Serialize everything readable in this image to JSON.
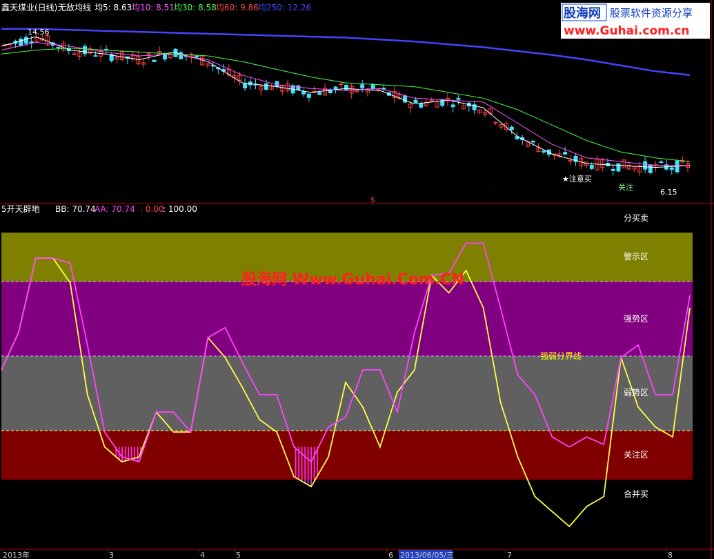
{
  "header": {
    "title": "鑫天煤业(日线)",
    "indicator_name": "无敌均线",
    "ma": [
      {
        "label": "均5: 8.63",
        "color": "#ffffff"
      },
      {
        "label": "均10: 8.51",
        "color": "#ff55ff"
      },
      {
        "label": "均30: 8.58",
        "color": "#44ff44"
      },
      {
        "label": "均60: 9.86",
        "color": "#ff4444"
      },
      {
        "label": "均250: 12.26",
        "color": "#4444ff"
      }
    ]
  },
  "watermark": {
    "logo_text": "股海网",
    "slogan": "股票软件资源分享",
    "url": "www.Guhai.com.cn",
    "center_text": "股海网 Www.Guhai.Com.CN"
  },
  "price_panel": {
    "high_label": "14.56",
    "low_label": "6.15",
    "signal_label": "★注意买",
    "signal_label2": "关注",
    "dollar_marker": "$"
  },
  "indicator_panel": {
    "name": "5开天辟地",
    "bb_label": "BB: 70.74",
    "aa_label": "AA: 70.74",
    "v1_label": ": 0.00",
    "v2_label": ": 100.00",
    "zones": [
      {
        "label": "分买卖",
        "color": "#000000"
      },
      {
        "label": "警示区",
        "color": "#808000"
      },
      {
        "label": "强势区",
        "color": "#800080"
      },
      {
        "label": "强弱分界线",
        "color": "#ffff00"
      },
      {
        "label": "弱势区",
        "color": "#606060"
      },
      {
        "label": "关注区",
        "color": "#800000"
      },
      {
        "label": "合并买",
        "color": "#000000"
      }
    ]
  },
  "x_axis": {
    "ticks": [
      "2013年",
      "3",
      "4",
      "5",
      "6",
      "2013/06/05/三",
      "7",
      "8"
    ]
  },
  "chart_data": [
    {
      "type": "line",
      "title": "鑫天煤业(日线) 无敌均线",
      "series": [
        {
          "name": "均5",
          "color": "#ffffff",
          "x": [
            0,
            10,
            20,
            30,
            40,
            50,
            60,
            70,
            80,
            90,
            100,
            110,
            120,
            130,
            140,
            150,
            160,
            170,
            180,
            190,
            200
          ],
          "values": [
            13.8,
            14.3,
            13.6,
            13.4,
            13.1,
            13.5,
            13.0,
            11.9,
            11.7,
            11.4,
            11.6,
            11.5,
            10.8,
            11.0,
            10.6,
            9.1,
            8.2,
            7.7,
            7.6,
            7.5,
            7.6
          ]
        },
        {
          "name": "均10",
          "color": "#ff55ff",
          "x": [
            0,
            10,
            20,
            30,
            40,
            50,
            60,
            70,
            80,
            90,
            100,
            110,
            120,
            130,
            140,
            150,
            160,
            170,
            180,
            190,
            200
          ],
          "values": [
            13.6,
            14.0,
            13.8,
            13.5,
            13.3,
            13.4,
            13.1,
            12.3,
            11.8,
            11.6,
            11.5,
            11.6,
            11.1,
            11.0,
            10.9,
            9.8,
            8.7,
            8.0,
            7.8,
            7.6,
            7.6
          ]
        },
        {
          "name": "均30",
          "color": "#44ff44",
          "x": [
            0,
            10,
            20,
            30,
            40,
            50,
            60,
            70,
            80,
            90,
            100,
            110,
            120,
            130,
            140,
            150,
            160,
            170,
            180,
            190,
            200
          ],
          "values": [
            13.4,
            13.6,
            13.7,
            13.6,
            13.5,
            13.4,
            13.3,
            13.0,
            12.6,
            12.2,
            11.9,
            11.8,
            11.7,
            11.4,
            11.1,
            10.5,
            9.7,
            8.9,
            8.3,
            8.0,
            7.8
          ]
        },
        {
          "name": "均250",
          "color": "#4444ff",
          "x": [
            0,
            10,
            20,
            30,
            40,
            50,
            60,
            70,
            80,
            90,
            100,
            110,
            120,
            130,
            140,
            150,
            160,
            170,
            180,
            190,
            200
          ],
          "values": [
            14.7,
            14.7,
            14.65,
            14.6,
            14.55,
            14.5,
            14.45,
            14.4,
            14.35,
            14.3,
            14.25,
            14.15,
            14.05,
            13.9,
            13.75,
            13.55,
            13.35,
            13.1,
            12.8,
            12.5,
            12.3
          ]
        }
      ],
      "annotations": [
        "14.56",
        "6.15",
        "★注意买",
        "关注"
      ]
    },
    {
      "type": "line",
      "title": "5开天辟地",
      "ylim": [
        -30,
        110
      ],
      "series": [
        {
          "name": "BB",
          "color": "#ff44ff",
          "x": [
            0,
            5,
            10,
            15,
            20,
            25,
            30,
            35,
            40,
            45,
            50,
            55,
            60,
            65,
            70,
            75,
            80,
            85,
            90,
            95,
            100,
            105,
            110,
            115,
            120,
            125,
            130,
            135,
            140,
            145,
            150,
            155,
            160,
            165,
            170,
            175,
            180,
            185,
            190,
            195,
            200
          ],
          "values": [
            45,
            60,
            90,
            90,
            88,
            55,
            20,
            10,
            8,
            28,
            28,
            20,
            58,
            62,
            48,
            35,
            35,
            14,
            8,
            22,
            26,
            45,
            45,
            28,
            60,
            83,
            84,
            96,
            96,
            70,
            43,
            35,
            18,
            14,
            18,
            15,
            50,
            55,
            35,
            35,
            75
          ]
        },
        {
          "name": "AA",
          "color": "#ffff44",
          "x": [
            0,
            5,
            10,
            15,
            20,
            25,
            30,
            35,
            40,
            45,
            50,
            55,
            60,
            65,
            70,
            75,
            80,
            85,
            90,
            95,
            100,
            105,
            110,
            115,
            120,
            125,
            130,
            135,
            140,
            145,
            150,
            155,
            160,
            165,
            170,
            175,
            180,
            185,
            190,
            195,
            200
          ],
          "values": [
            45,
            60,
            90,
            90,
            80,
            35,
            14,
            8,
            10,
            28,
            20,
            20,
            58,
            50,
            38,
            25,
            20,
            2,
            -2,
            10,
            40,
            30,
            14,
            36,
            45,
            83,
            76,
            85,
            70,
            32,
            10,
            -6,
            -12,
            -18,
            -10,
            -6,
            50,
            30,
            22,
            18,
            70
          ]
        }
      ]
    }
  ]
}
